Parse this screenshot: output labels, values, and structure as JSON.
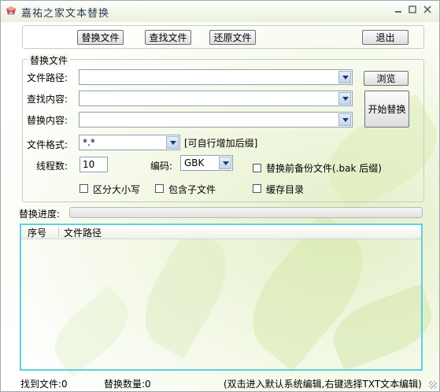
{
  "window": {
    "title": "嘉祐之家文本替换"
  },
  "toolbar": {
    "replace_files": "替换文件",
    "find_files": "查找文件",
    "restore_files": "还原文件",
    "exit": "退出"
  },
  "replace_group": {
    "legend": "替换文件",
    "path_label": "文件路径:",
    "path_value": "",
    "find_label": "查找内容:",
    "find_value": "",
    "replace_label": "替换内容:",
    "replace_value": "",
    "browse_button": "浏览",
    "start_button": "开始替换",
    "format_label": "文件格式:",
    "format_value": "*.*",
    "format_hint": "[可自行增加后缀]",
    "threads_label": "线程数:",
    "threads_value": "10",
    "encoding_label": "编码:",
    "encoding_value": "GBK",
    "backup_label": "替换前备份文件(.bak 后缀)",
    "backup_checked": false,
    "case_label": "区分大小写",
    "case_checked": false,
    "subfolder_label": "包含子文件",
    "subfolder_checked": false,
    "cache_label": "缓存目录",
    "cache_checked": false
  },
  "progress": {
    "label": "替换进度:",
    "value": 0
  },
  "results": {
    "columns": [
      "序号",
      "文件路径"
    ],
    "rows": []
  },
  "status": {
    "found": "找到文件:0",
    "replaced": "替换数量:0",
    "hint": "(双击进入默认系统编辑,右键选择TXT文本编辑)"
  }
}
